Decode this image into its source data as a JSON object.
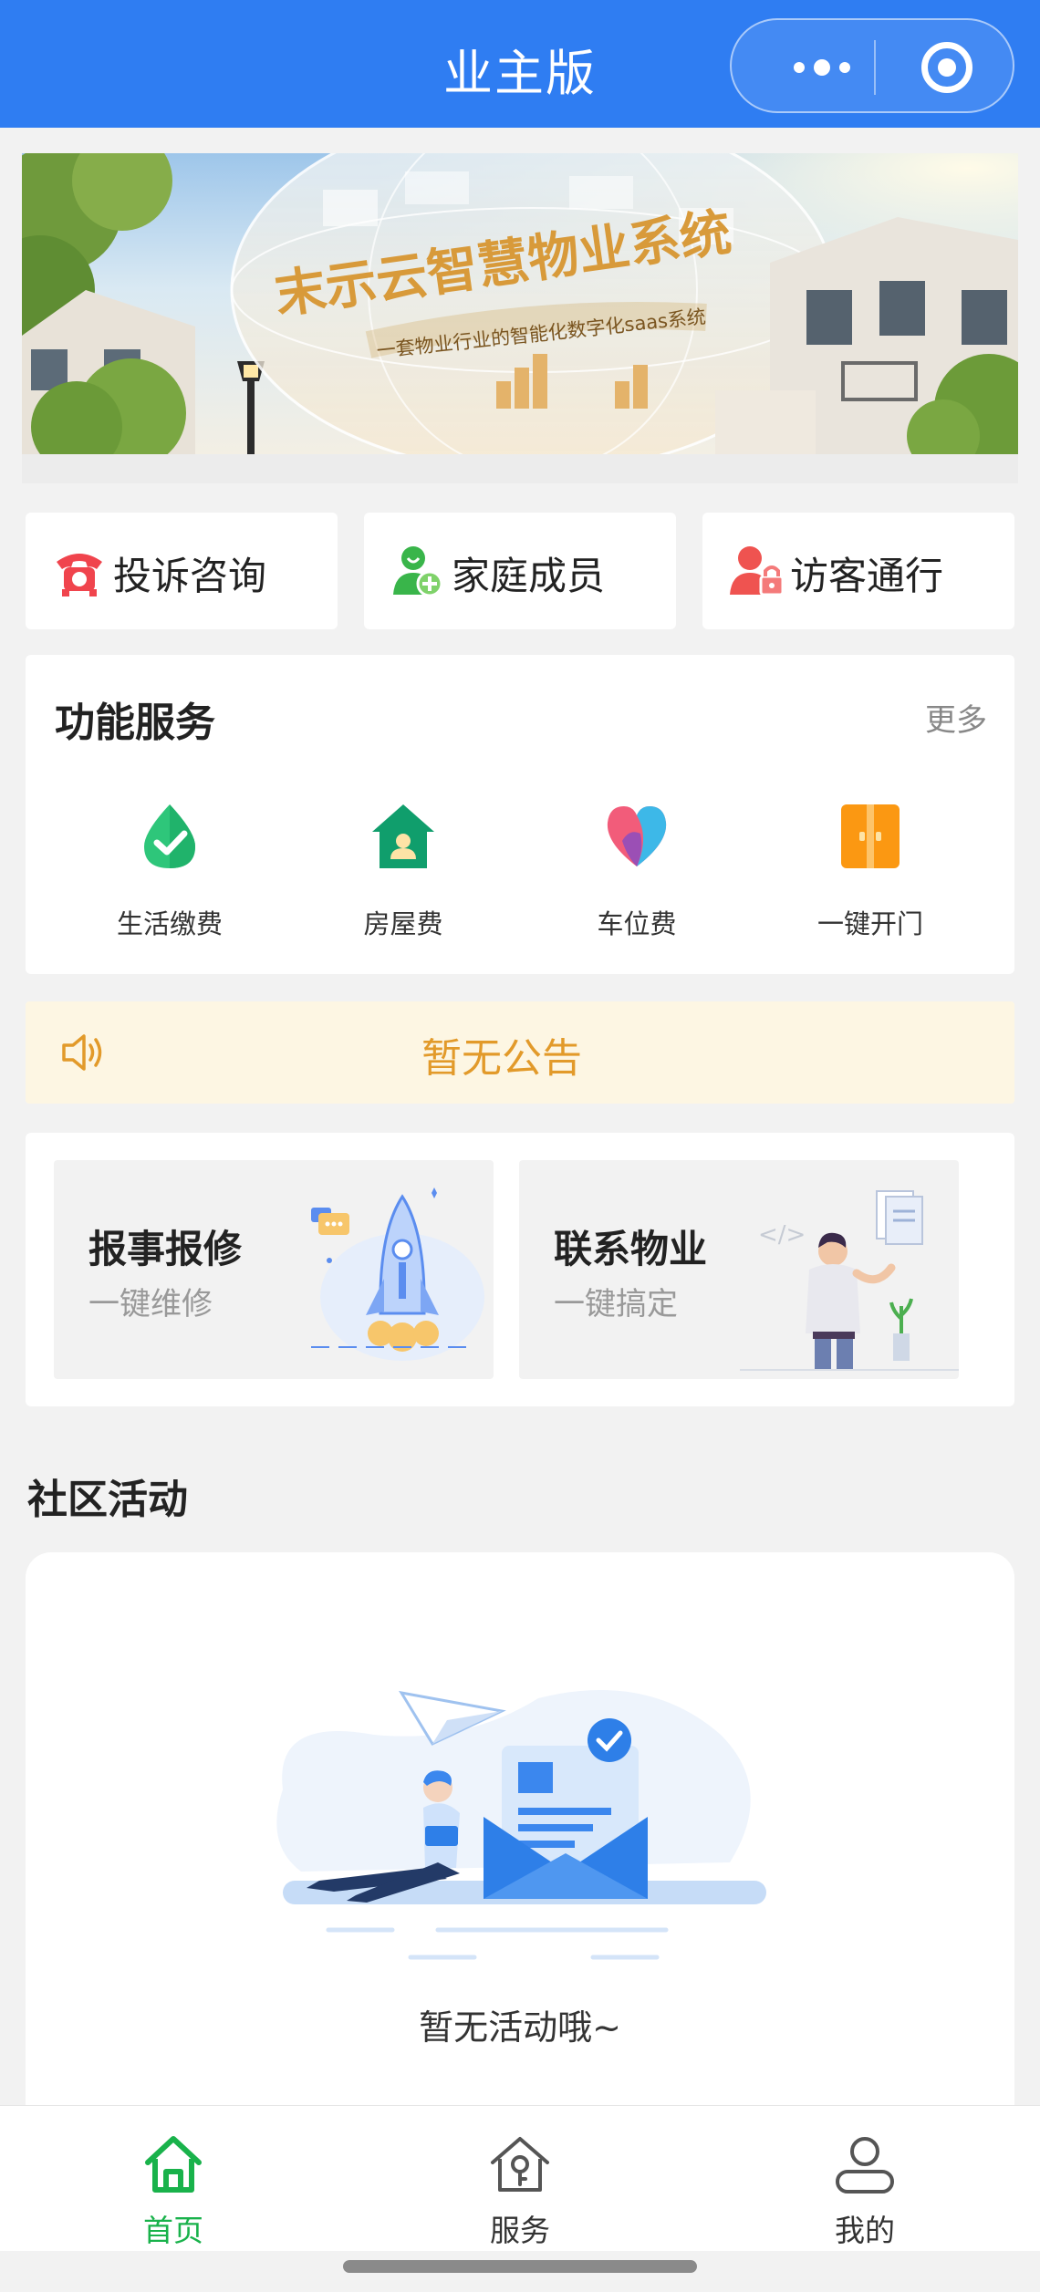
{
  "navbar": {
    "title": "业主版"
  },
  "banner": {
    "headline": "末示云智慧物业系统",
    "tagline": "一套物业行业的智能化数字化saas系统"
  },
  "quick_actions": [
    {
      "label": "投诉咨询",
      "icon": "phone-icon",
      "color": "#f0444d"
    },
    {
      "label": "家庭成员",
      "icon": "family-member-icon",
      "color": "#39b54a"
    },
    {
      "label": "访客通行",
      "icon": "visitor-lock-icon",
      "color": "#ef5350"
    }
  ],
  "services": {
    "title": "功能服务",
    "more_label": "更多",
    "items": [
      {
        "label": "生活缴费",
        "icon": "drop-check-icon"
      },
      {
        "label": "房屋费",
        "icon": "house-icon"
      },
      {
        "label": "车位费",
        "icon": "heart-icon"
      },
      {
        "label": "一键开门",
        "icon": "door-icon"
      }
    ]
  },
  "notice": {
    "text": "暂无公告",
    "icon": "speaker-icon"
  },
  "cards": [
    {
      "title": "报事报修",
      "subtitle": "一键维修"
    },
    {
      "title": "联系物业",
      "subtitle": "一键搞定"
    }
  ],
  "activity": {
    "section_title": "社区活动",
    "empty_text": "暂无活动哦~"
  },
  "tabbar": [
    {
      "label": "首页",
      "icon": "home-icon",
      "active": true
    },
    {
      "label": "服务",
      "icon": "service-house-icon",
      "active": false
    },
    {
      "label": "我的",
      "icon": "user-icon",
      "active": false
    }
  ],
  "colors": {
    "navbar": "#2f7df2",
    "active_tab": "#19b24b",
    "notice_text": "#e29a2a",
    "notice_bg": "#fdf6e3"
  }
}
